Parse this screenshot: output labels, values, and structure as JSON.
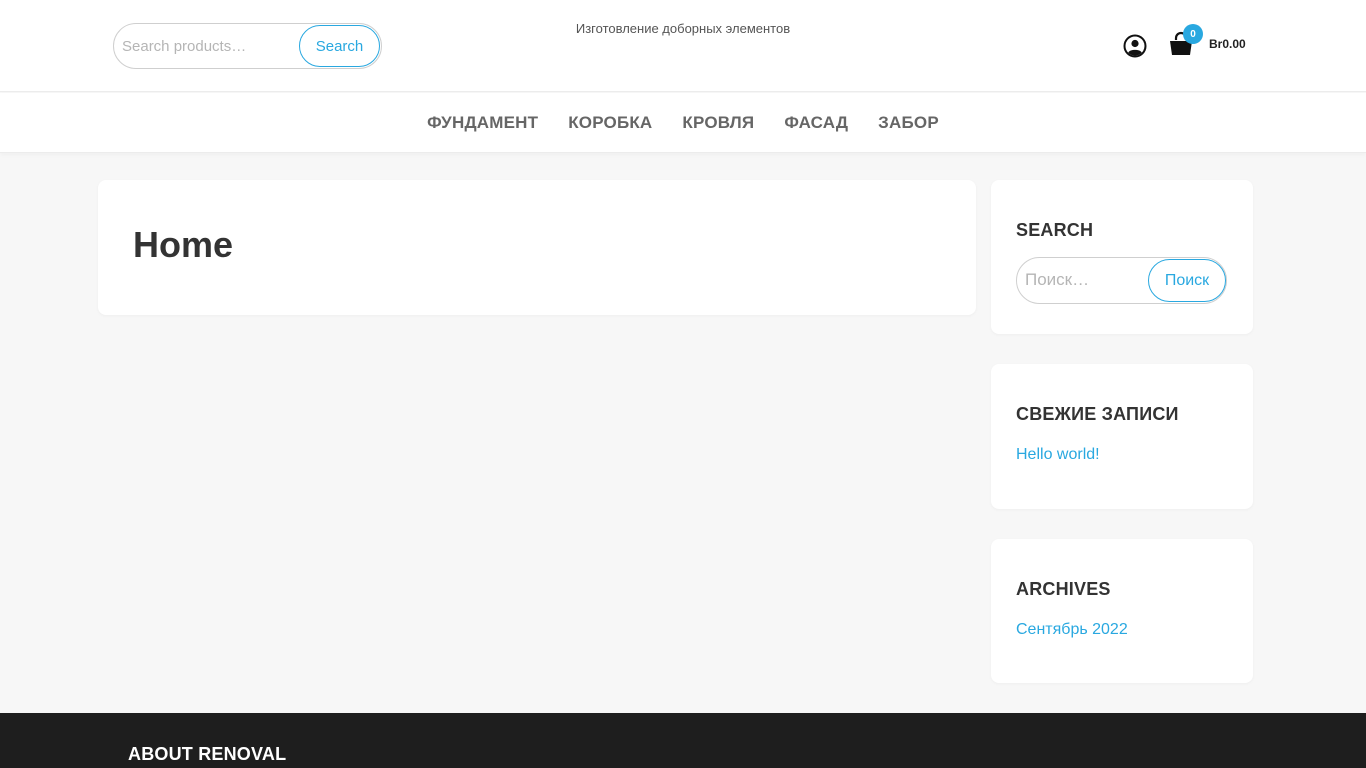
{
  "header": {
    "search": {
      "placeholder": "Search products…",
      "button_label": "Search"
    },
    "tagline": "Изготовление доборных элементов",
    "account_icon": "user-circle-icon",
    "cart": {
      "icon": "shopping-bag-icon",
      "count": "0",
      "total": "Br0.00"
    }
  },
  "nav": {
    "items": [
      {
        "label": "ФУНДАМЕНТ"
      },
      {
        "label": "КОРОБКА"
      },
      {
        "label": "КРОВЛЯ"
      },
      {
        "label": "ФАСАД"
      },
      {
        "label": "ЗАБОР"
      }
    ]
  },
  "main": {
    "title": "Home"
  },
  "sidebar": {
    "search": {
      "title": "SEARCH",
      "placeholder": "Поиск…",
      "button_label": "Поиск"
    },
    "recent": {
      "title": "СВЕЖИЕ ЗАПИСИ",
      "items": [
        {
          "label": "Hello world!"
        }
      ]
    },
    "archives": {
      "title": "ARCHIVES",
      "items": [
        {
          "label": "Сентябрь 2022"
        }
      ]
    }
  },
  "footer": {
    "title": "ABOUT RENOVAL"
  },
  "colors": {
    "accent": "#29a8e0",
    "background": "#f7f7f7",
    "footer": "#1e1e1e"
  }
}
